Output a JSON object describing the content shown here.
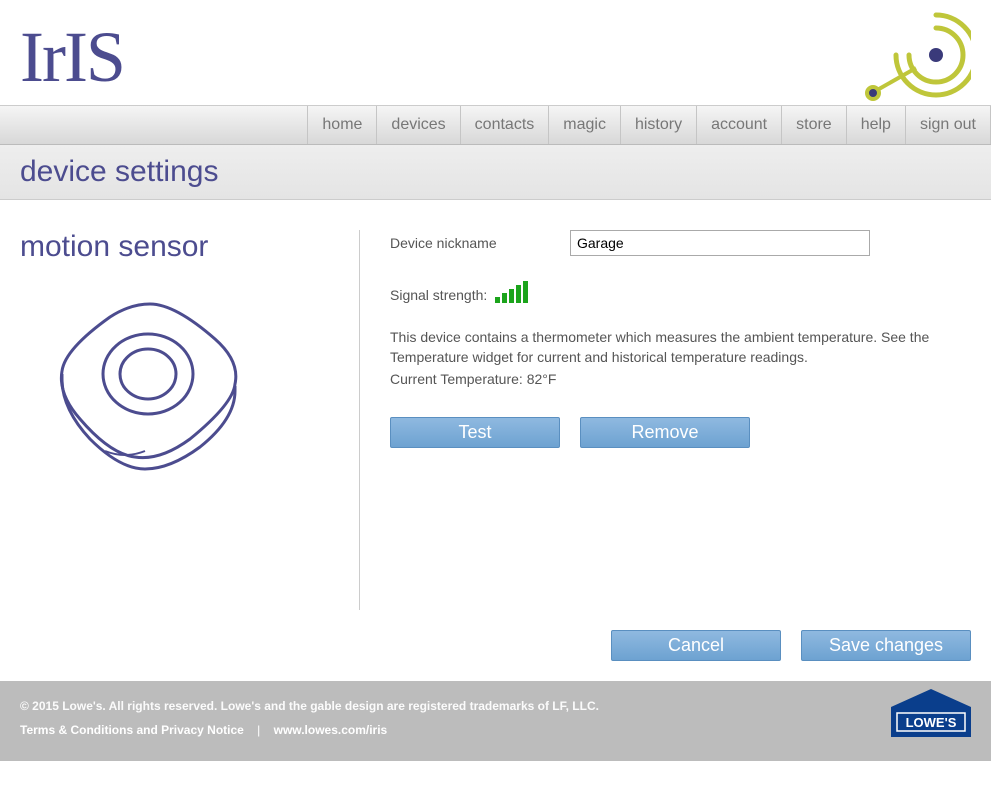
{
  "header": {
    "brand": "IrIS"
  },
  "nav": {
    "items": [
      "home",
      "devices",
      "contacts",
      "magic",
      "history",
      "account",
      "store",
      "help",
      "sign out"
    ]
  },
  "page": {
    "title": "device settings",
    "device_type": "motion sensor"
  },
  "form": {
    "nickname_label": "Device nickname",
    "nickname_value": "Garage",
    "signal_label": "Signal strength:",
    "signal_bars": 5,
    "description": "This device contains a thermometer which measures the ambient temperature. See the Temperature widget for current and historical temperature readings.",
    "current_temp_label": "Current Temperature: 82°F",
    "test_label": "Test",
    "remove_label": "Remove"
  },
  "actions": {
    "cancel": "Cancel",
    "save": "Save changes"
  },
  "footer": {
    "copyright": "© 2015 Lowe's. All rights reserved. Lowe's and the gable design are registered trademarks of LF, LLC.",
    "terms": "Terms & Conditions and Privacy Notice",
    "link": "www.lowes.com/iris",
    "lowes": "LOWE'S"
  }
}
